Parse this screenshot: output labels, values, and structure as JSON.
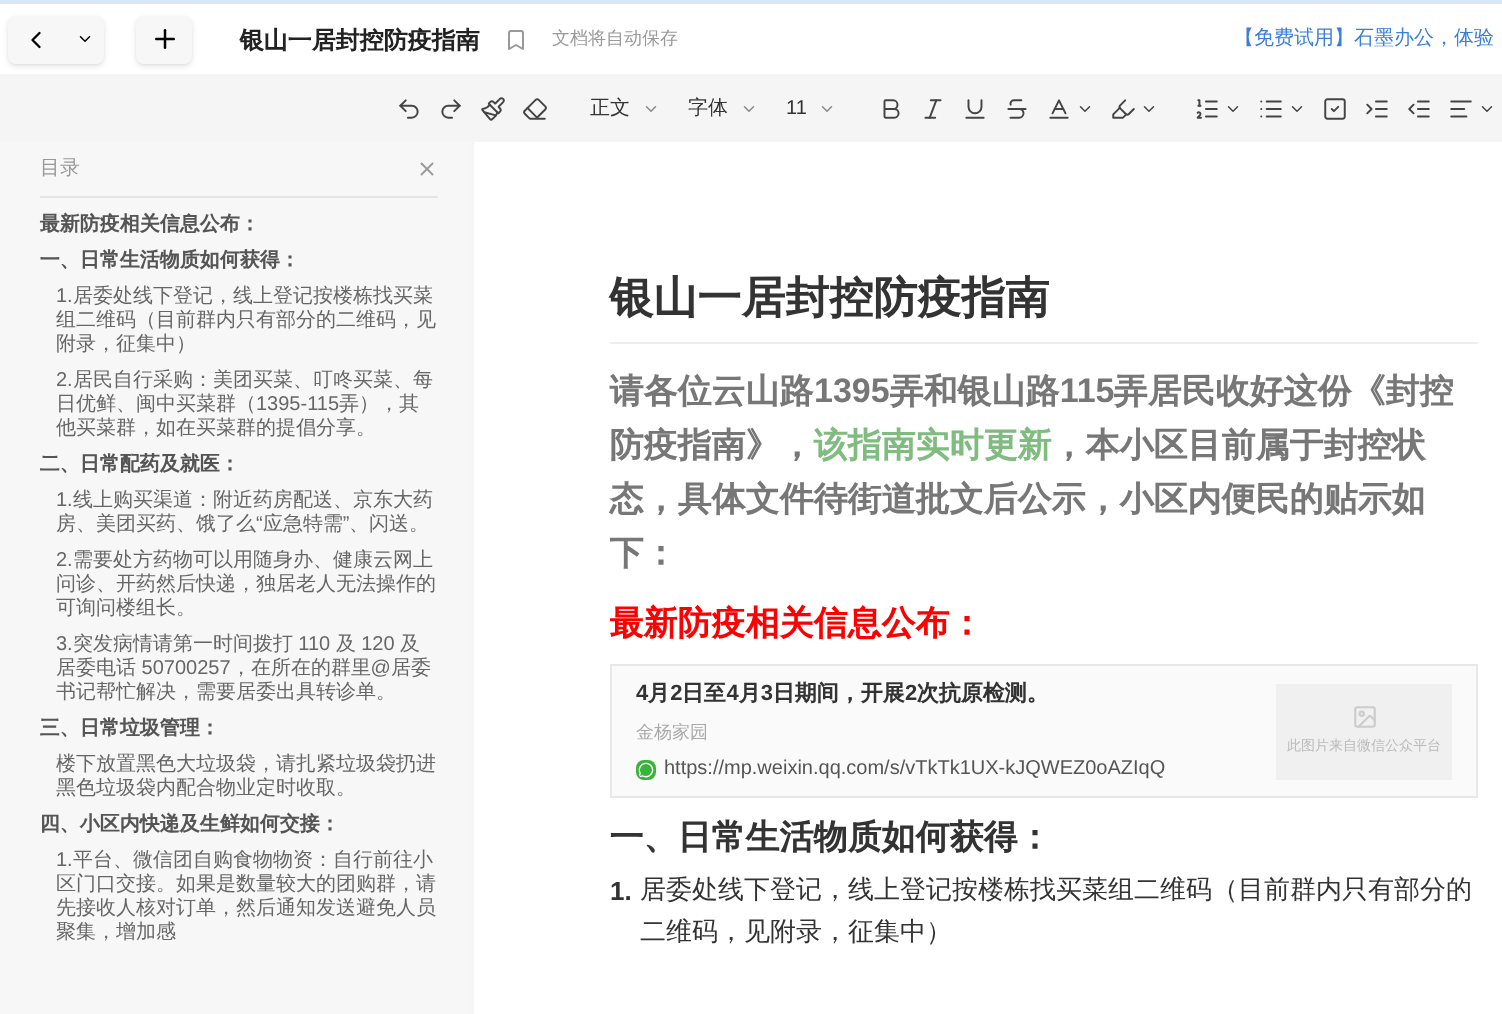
{
  "topbar": {
    "title": "银山一居封控防疫指南",
    "save_status": "文档将自动保存",
    "promo": "【免费试用】石墨办公，体验"
  },
  "toolbar": {
    "style_select": "正文",
    "font_select": "字体",
    "size_select": "11"
  },
  "outline": {
    "title": "目录",
    "items": [
      {
        "text": "最新防疫相关信息公布："
      },
      {
        "text": "一、日常生活物质如何获得：",
        "children": [
          {
            "text": "1.居委处线下登记，线上登记按楼栋找买菜组二维码（目前群内只有部分的二维码，见附录，征集中）"
          },
          {
            "text": "2.居民自行采购：美团买菜、叮咚买菜、每日优鲜、闽中买菜群（1395-115弄），其他买菜群，如在买菜群的提倡分享。"
          }
        ]
      },
      {
        "text": "二、日常配药及就医：",
        "children": [
          {
            "text": "1.线上购买渠道：附近药房配送、京东大药房、美团买药、饿了么“应急特需”、闪送。"
          },
          {
            "text": "2.需要处方药物可以用随身办、健康云网上问诊、开药然后快递，独居老人无法操作的可询问楼组长。"
          },
          {
            "text": "3.突发病情请第一时间拨打 110 及 120 及居委电话 50700257，在所在的群里@居委书记帮忙解决，需要居委出具转诊单。"
          }
        ]
      },
      {
        "text": "三、日常垃圾管理：",
        "children": [
          {
            "text": "楼下放置黑色大垃圾袋，请扎紧垃圾袋扔进黑色垃圾袋内配合物业定时收取。"
          }
        ]
      },
      {
        "text": "四、小区内快递及生鲜如何交接：",
        "children": [
          {
            "text": "1.平台、微信团自购食物物资：自行前往小区门口交接。如果是数量较大的团购群，请先接收人核对订单，然后通知发送避免人员聚集，增加感"
          }
        ]
      }
    ]
  },
  "document": {
    "title": "银山一居封控防疫指南",
    "intro": [
      {
        "kind": "normal",
        "text": "请各位云山路1395弄和银山路115弄居民收好这份《封控防疫指南》，"
      },
      {
        "kind": "highlight",
        "text": "该指南实时更新"
      },
      {
        "kind": "normal",
        "text": "，本小区目前属于封控状态，具体文件待街道批文后公示，小区内便民的贴示如下："
      }
    ],
    "notice_heading": "最新防疫相关信息公布：",
    "link_card": {
      "title": "4月2日至4月3日期间，开展2次抗原检测。",
      "source": "金杨家园",
      "url": "https://mp.weixin.qq.com/s/vTkTk1UX-kJQWEZ0oAZIqQ",
      "image_caption": "此图片来自微信公众平台"
    },
    "section_heading": "一、日常生活物质如何获得：",
    "list": [
      {
        "number": "1.",
        "text": "居委处线下登记，线上登记按楼栋找买菜组二维码（目前群内只有部分的二维码，见附录，征集中）"
      }
    ]
  }
}
